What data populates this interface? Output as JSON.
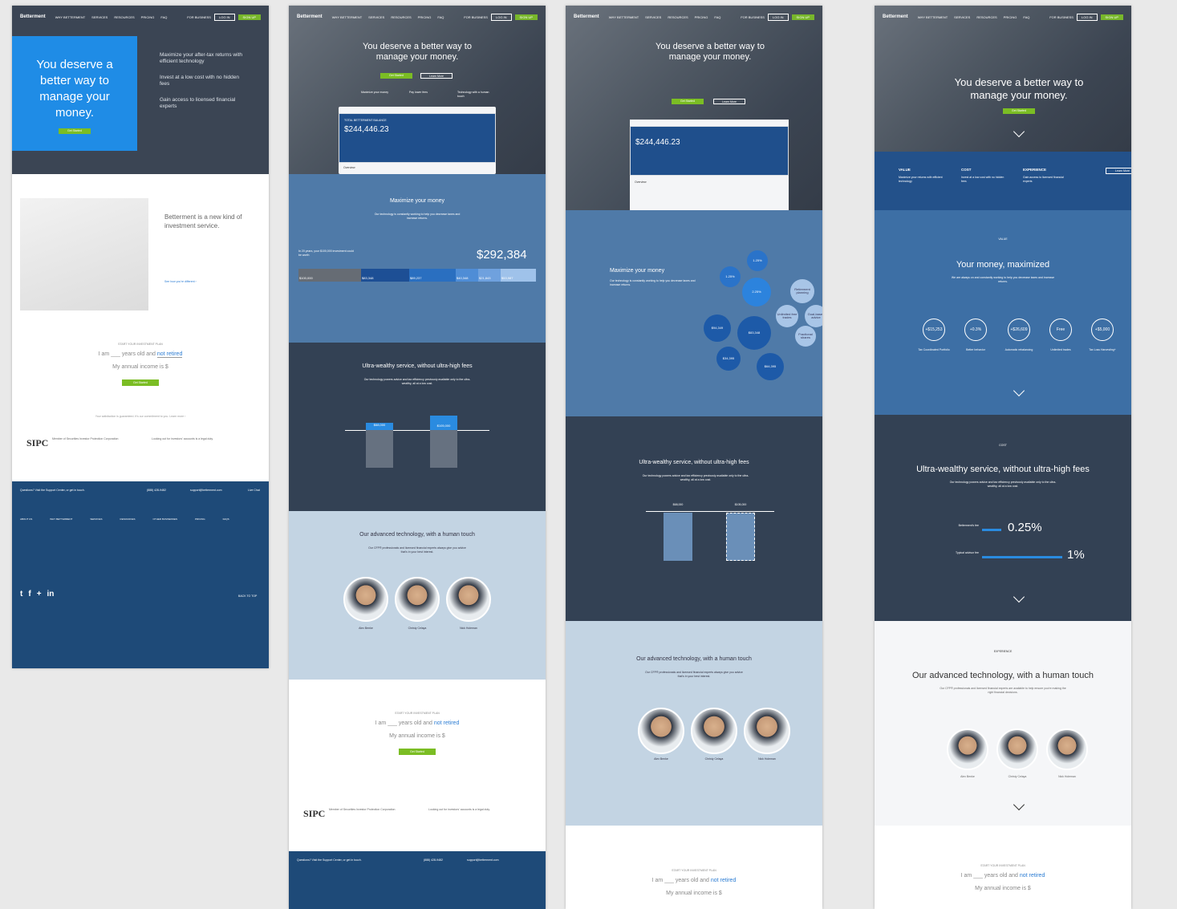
{
  "brand": "Betterment",
  "nav": {
    "links": [
      "WHY BETTERMENT",
      "SERVICES",
      "RESOURCES",
      "PRICING",
      "FAQ"
    ],
    "business": "FOR BUSINESS",
    "login": "LOG IN",
    "signup": "SIGN UP"
  },
  "hero": {
    "title": "You deserve a better way to manage your money.",
    "cta": "Get Started",
    "learn": "Learn More"
  },
  "v1": {
    "title": "You deserve a better way to manage your money.",
    "bullets": [
      "Maximize your after-tax returns with efficient technology",
      "Invest at a low cost with no hidden fees",
      "Gain access to licensed financial experts"
    ],
    "cta": "Get Started",
    "intro_title": "Betterment is a new kind of investment service.",
    "intro_link": "See how you're different ›",
    "plan_label": "START YOUR INVESTMENT PLAN",
    "plan_i_am": "I am",
    "plan_years": "years old and",
    "plan_status": "not retired",
    "plan_income": "My annual income is $",
    "plan_cta": "Get Started",
    "guarantee": "Your satisfaction is guaranteed. It's our commitment to you. Learn more ›",
    "sipc_title": "Member of Securities Investor Protection Corporation",
    "fiduciary_title": "Looking out for investors' accounts is a legal duty.",
    "footer_q": "Questions? Visit the Support Center, or get in touch.",
    "phone": "(888) 428-9482",
    "email": "support@betterment.com",
    "chat": "Live Chat",
    "footer_cols": [
      "ABOUT US",
      "WHY BETTERMENT",
      "SERVICES",
      "RESOURCES",
      "OTHER BUSINESSES",
      "PRICING",
      "FAQS"
    ],
    "back_top": "BACK TO TOP"
  },
  "v2": {
    "triad": [
      "Maximize your money",
      "Pay lower fees",
      "Technology with a human touch"
    ],
    "balance_label": "TOTAL BETTERMENT BALANCE",
    "balance": "$244,446.23",
    "overview": "Overview",
    "maximize_title": "Maximize your money",
    "maximize_sub": "Our technology is constantly working to help you decrease taxes and increase returns.",
    "twenty_years": "In 20 years, your $100,000 investment could be worth",
    "total": "$292,384",
    "bar_vals": [
      "$100,000",
      "$83,348",
      "$89,237",
      "$40,348",
      "$21,843",
      "$53,987"
    ],
    "bar_labels": [
      "Your initial investment",
      "Human investing",
      "Better behavior",
      "Automatic rebalancing",
      "Tax Loss Harvesting+",
      "Tax Coordinated Portfolio"
    ],
    "ultra_title": "Ultra-wealthy service, without ultra-high fees",
    "ultra_sub": "Our technology powers advice and tax efficiency previously available only to the ultra-wealthy, all at a low cost.",
    "fee_vals": [
      "$68,000",
      "$105,000",
      "$100,000",
      "$100,000"
    ],
    "advanced_title": "Our advanced technology, with a human touch",
    "advanced_sub": "Our CFP® professionals and licensed financial experts always give you advice that's in your best interest.",
    "people": [
      "Alex Benke",
      "Christy Celaya",
      "Nick Holeman"
    ],
    "cfp": "CFP®"
  },
  "v3": {
    "maximize_title": "Maximize your money",
    "maximize_sub": "Our technology is constantly working to help you decrease taxes and increase returns.",
    "bubbles": [
      "1.25%",
      "1.25%",
      "2.25%",
      "$94,349",
      "$83,348",
      "$34,395",
      "$64,395",
      "Retirement planning",
      "Unlimited free trades",
      "Goal-based advice",
      "Fractional shares"
    ],
    "fee_vals": [
      "$68,000",
      "$105,000"
    ],
    "ultra_title": "Ultra-wealthy service, without ultra-high fees",
    "advanced_title": "Our advanced technology, with a human touch"
  },
  "v4": {
    "pillars": [
      "VALUE",
      "COST",
      "EXPERIENCE"
    ],
    "pillar_sub": [
      "Maximize your returns with efficient technology",
      "Invest at a low cost with no hidden fees",
      "Gain access to licensed financial experts"
    ],
    "learn": "Learn More",
    "value_label": "VALUE",
    "value_title": "Your money, maximized",
    "value_sub": "We are always on and constantly working to help you decrease taxes and increase returns.",
    "rings": [
      "+$15,253",
      "+0.3%",
      "+$26,609",
      "Free",
      "+$5,000"
    ],
    "ring_labels": [
      "Tax Coordinated Portfolio",
      "Better behavior",
      "Automatic rebalancing",
      "Unlimited trades",
      "Tax Loss Harvesting+"
    ],
    "cost_label": "COST",
    "cost_title": "Ultra-wealthy service, without ultra-high fees",
    "cost_sub": "Our technology powers advice and tax efficiency previously available only to the ultra-wealthy, all at a low cost.",
    "bm_fee_label": "Betterment's fee",
    "bm_fee": "0.25%",
    "adv_fee_label": "Typical advisor fee",
    "adv_fee": "1%",
    "exp_label": "EXPERIENCE",
    "exp_title": "Our advanced technology, with a human touch",
    "exp_sub": "Our CFP® professionals and licensed financial experts are available to help ensure you're making the right financial decisions."
  }
}
